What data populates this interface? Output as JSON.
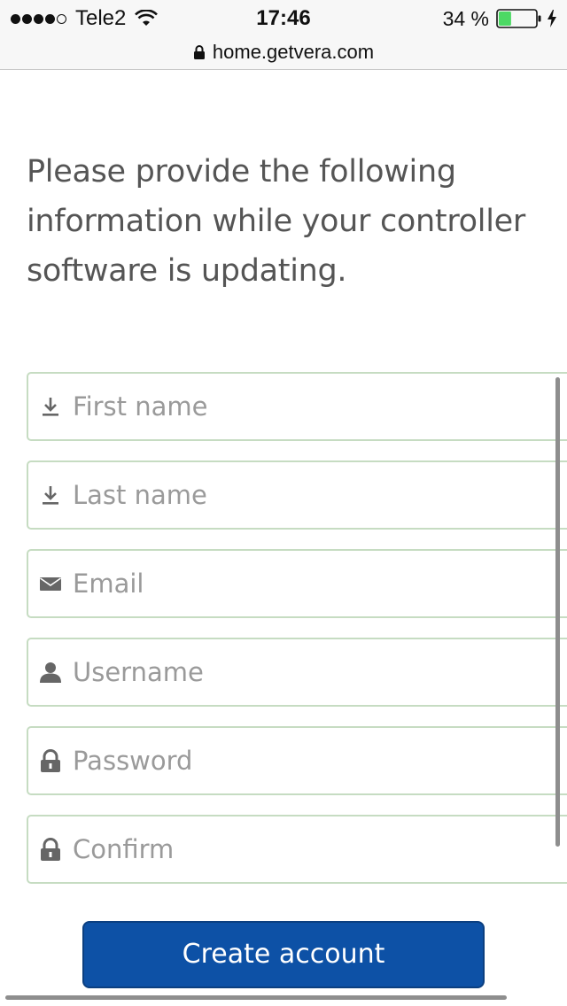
{
  "status_bar": {
    "carrier": "Tele2",
    "time": "17:46",
    "battery_percent": "34 %",
    "battery_level": 0.34,
    "signal_bars_filled": 4,
    "signal_bars_total": 5
  },
  "browser": {
    "url": "home.getvera.com"
  },
  "form": {
    "headline": "Please provide the following information while your controller software is updating.",
    "fields": [
      {
        "placeholder": "First name",
        "icon": "download-arrow-icon"
      },
      {
        "placeholder": "Last name",
        "icon": "download-arrow-icon"
      },
      {
        "placeholder": "Email",
        "icon": "envelope-icon"
      },
      {
        "placeholder": "Username",
        "icon": "user-icon"
      },
      {
        "placeholder": "Password",
        "icon": "padlock-icon"
      },
      {
        "placeholder": "Confirm",
        "icon": "padlock-icon"
      }
    ],
    "submit_label": "Create account"
  },
  "colors": {
    "button": "#0d51a6",
    "field_border": "#c6dcc2",
    "battery_fill": "#4cd964"
  }
}
